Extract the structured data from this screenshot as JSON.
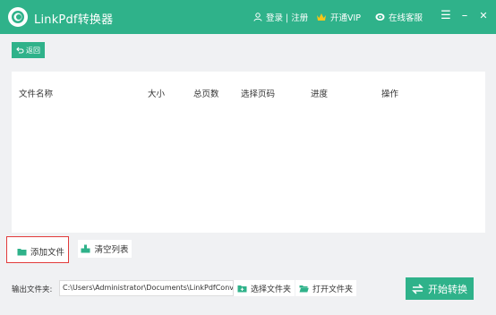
{
  "window": {
    "title": "LinkPdf转换器",
    "menu": {
      "login": "登录 | 注册",
      "vip": "开通VIP",
      "service": "在线客服"
    },
    "controls": {
      "menu": "☰",
      "minimize": "–",
      "close": "✕"
    }
  },
  "toolbar": {
    "back_label": "返回"
  },
  "file_table": {
    "columns": [
      "文件名称",
      "大小",
      "总页数",
      "选择页码",
      "进度",
      "操作"
    ]
  },
  "actions": {
    "add_file": "添加文件",
    "clear_list": "清空列表"
  },
  "output": {
    "label": "输出文件夹:",
    "path": "C:\\Users\\Administrator\\Documents\\LinkPdfConverter",
    "select_folder": "选择文件夹",
    "open_folder": "打开文件夹"
  },
  "start_button": "开始转换",
  "colors": {
    "accent": "#2fb28a",
    "highlight_border": "#e23b3b"
  }
}
